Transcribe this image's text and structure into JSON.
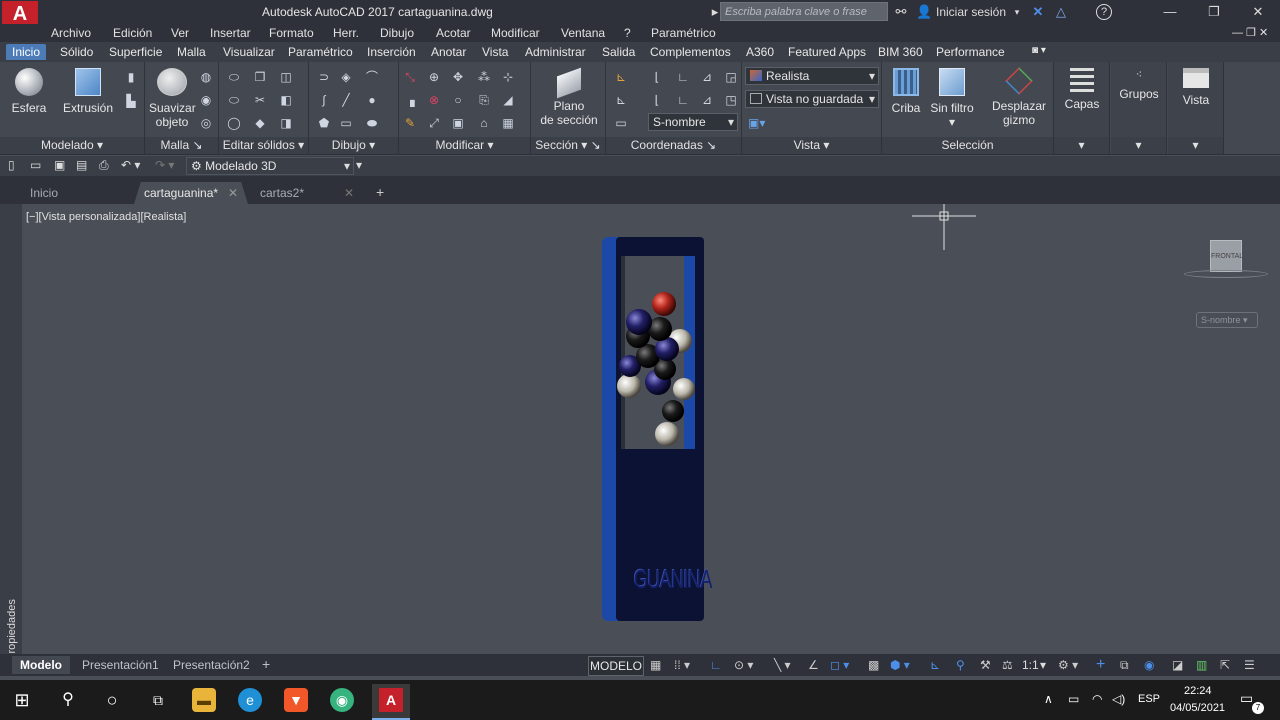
{
  "window": {
    "app_logo": "A",
    "title": "Autodesk AutoCAD 2017    cartaguanina.dwg",
    "search_placeholder": "Escriba palabra clave o frase",
    "signin": "Iniciar sesión",
    "help": "?",
    "controls": {
      "minimize": "—",
      "maximize": "❐",
      "close": "✕"
    }
  },
  "menu": [
    "Archivo",
    "Edición",
    "Ver",
    "Insertar",
    "Formato",
    "Herr.",
    "Dibujo",
    "Acotar",
    "Modificar",
    "Ventana",
    "?",
    "Paramétrico"
  ],
  "ribbon_tabs": [
    "Inicio",
    "Sólido",
    "Superficie",
    "Malla",
    "Visualizar",
    "Paramétrico",
    "Inserción",
    "Anotar",
    "Vista",
    "Administrar",
    "Salida",
    "Complementos",
    "A360",
    "Featured Apps",
    "BIM 360",
    "Performance"
  ],
  "ribbon": {
    "modelado": {
      "title": "Modelado",
      "esfera": "Esfera",
      "extrusion": "Extrusión"
    },
    "malla": {
      "title": "Malla",
      "suavizar": "Suavizar",
      "objeto": "objeto"
    },
    "editar_solidos": {
      "title": "Editar sólidos"
    },
    "dibujo": {
      "title": "Dibujo"
    },
    "modificar": {
      "title": "Modificar"
    },
    "seccion": {
      "title": "Sección",
      "plano": "Plano",
      "de_seccion": "de sección"
    },
    "coordenadas": {
      "title": "Coordenadas",
      "combo": "S-nombre"
    },
    "vista": {
      "title": "Vista",
      "style": "Realista",
      "view": "Vista no guardada"
    },
    "seleccion": {
      "title": "Selección",
      "criba": "Criba",
      "sin_filtro": "Sin filtro",
      "desplazar": "Desplazar",
      "gizmo": "gizmo"
    },
    "capas": "Capas",
    "grupos": "Grupos",
    "vista_btn": "Vista"
  },
  "workspace": "Modelado 3D",
  "doc_tabs": [
    "Inicio",
    "cartaguanina*",
    "cartas2*"
  ],
  "viewport": {
    "label": "[−][Vista personalizada][Realista]",
    "model_text": "GUANINA",
    "viewcube": "FRONTAL",
    "ucs": "S-nombre"
  },
  "side_panel": "Propiedades",
  "layout_tabs": [
    "Modelo",
    "Presentación1",
    "Presentación2"
  ],
  "status": {
    "mode": "MODELO",
    "scale": "1:1"
  },
  "taskbar": {
    "lang": "ESP",
    "time": "22:24",
    "date": "04/05/2021",
    "notifications": "7"
  },
  "colors": {
    "accent": "#4c7bb8",
    "card": "#0b1233",
    "frame": "#1c49a8",
    "logo": "#c4212b"
  }
}
